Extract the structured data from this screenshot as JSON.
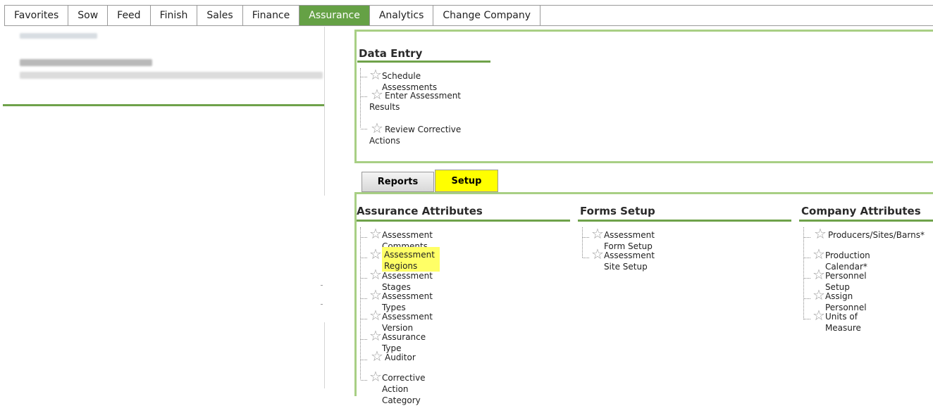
{
  "menu": {
    "items": [
      "Favorites",
      "Sow",
      "Feed",
      "Finish",
      "Sales",
      "Finance",
      "Assurance",
      "Analytics",
      "Change Company"
    ],
    "active": "Assurance"
  },
  "data_entry": {
    "title": "Data Entry",
    "items": [
      "Schedule Assessments",
      "Enter Assessment Results",
      "Review Corrective Actions"
    ]
  },
  "tabs": [
    "Reports",
    "Setup"
  ],
  "active_tab": "Setup",
  "assurance_attributes": {
    "title": "Assurance Attributes",
    "items": [
      "Assessment Comments",
      "Assessment Regions",
      "Assessment Stages",
      "Assessment Types",
      "Assessment Version",
      "Assurance Type",
      "Auditor",
      "Corrective Action Category"
    ],
    "highlighted": "Assessment Regions"
  },
  "forms_setup": {
    "title": "Forms Setup",
    "items": [
      "Assessment Form Setup",
      "Assessment Site Setup"
    ]
  },
  "company_attributes": {
    "title": "Company Attributes",
    "items": [
      "Producers/Sites/Barns*",
      "Production Calendar*",
      "Personnel Setup",
      "Assign Personnel",
      "Units of Measure"
    ]
  },
  "colors": {
    "accent_green": "#65a145",
    "panel_border": "#a8cf84",
    "highlight": "#ffff66",
    "active_tab": "#ffff00"
  },
  "icons": {
    "favorite": "star-icon"
  }
}
